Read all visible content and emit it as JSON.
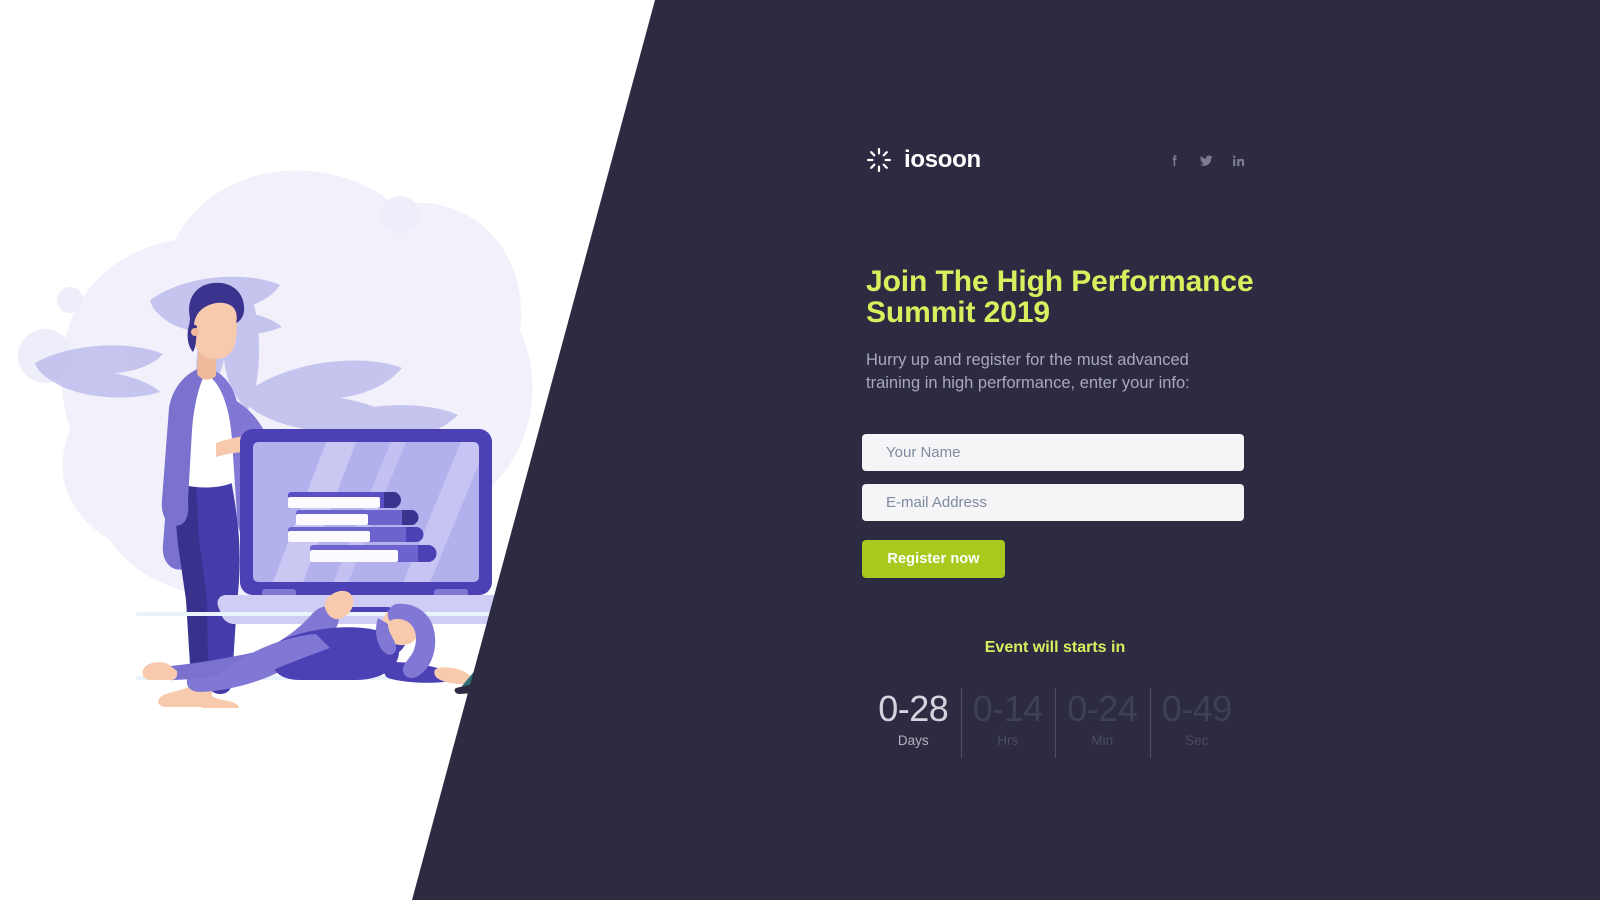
{
  "brand": {
    "name": "iosoon",
    "logo_icon": "sunburst-spinner-icon"
  },
  "socials": [
    {
      "name": "facebook",
      "icon": "facebook-icon",
      "label": "Facebook"
    },
    {
      "name": "twitter",
      "icon": "twitter-icon",
      "label": "Twitter"
    },
    {
      "name": "linkedin",
      "icon": "linkedin-icon",
      "label": "LinkedIn"
    }
  ],
  "hero": {
    "title_line1": "Join The High Performance",
    "title_line2": "Summit 2019",
    "subtitle_line1": "Hurry up and register for the must advanced",
    "subtitle_line2": "training in high performance, enter your info:"
  },
  "form": {
    "name_placeholder": "Your Name",
    "name_value": "",
    "email_placeholder": "E-mail Address",
    "email_value": "",
    "submit_label": "Register now"
  },
  "countdown": {
    "heading": "Event will starts in",
    "units": [
      {
        "value": "0-28",
        "label": "Days",
        "state": "active"
      },
      {
        "value": "0-14",
        "label": "Hrs",
        "state": "dim"
      },
      {
        "value": "0-24",
        "label": "Min",
        "state": "dim"
      },
      {
        "value": "0-49",
        "label": "Sec",
        "state": "dim"
      }
    ]
  },
  "illustration": {
    "name": "remote-learning-illustration",
    "description": "Standing person beside a large laptop showing a stack of books, with a second person lying on the floor using a laptop, palm leaves and pastel blobs in the background"
  },
  "colors": {
    "panel_dark": "#2c2b42",
    "accent_yellow": "#dbee5e",
    "accent_green": "#a8ca1f",
    "page_white": "#ffffff",
    "field_bg": "#f5f5f7",
    "muted_text": "#a9a8ba",
    "social_icon": "#7c7b91",
    "illus_purple": "#7b6fd0",
    "illus_deep": "#3b3494",
    "illus_light": "#b6b4ee",
    "illus_pale": "#eceaf9",
    "skin": "#f7c9ad"
  }
}
